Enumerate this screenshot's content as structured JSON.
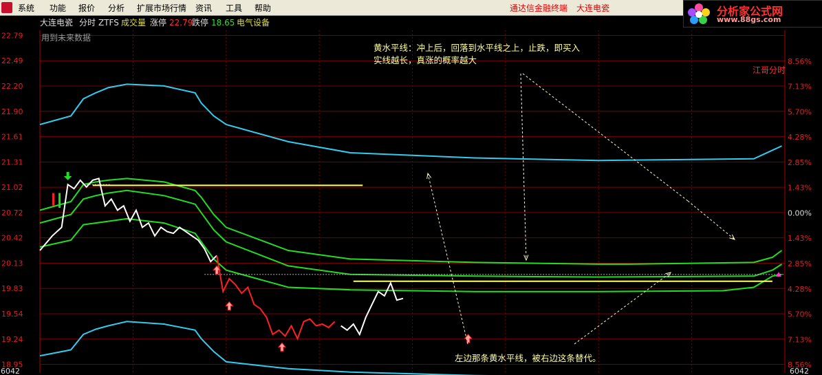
{
  "menubar": {
    "items": [
      "系统",
      "功能",
      "报价",
      "分析",
      "扩展市场行情",
      "资讯",
      "工具",
      "帮助"
    ],
    "app_title": "通达信金融终端",
    "stock_title": "大连电瓷"
  },
  "logo": {
    "line1": "分析家公式网",
    "line2": "www.88gs.com"
  },
  "header": {
    "stock": "大连电瓷",
    "view": "分时",
    "formula": "ZTFS",
    "volume_label": "成交量",
    "limit_up_label": "涨停",
    "limit_up": "22.79",
    "limit_down_label": "跌停",
    "limit_down": "18.65",
    "sector": "电气设备",
    "future_data": "用到未来数据",
    "indicator": "江哥分时"
  },
  "annotations": {
    "note1_line1": "黄水平线：冲上后，回落到水平线之上，止跌，即买入",
    "note1_line2": "实线越长，真涨的概率越大",
    "note2": "左边那条黄水平线，被右边这条替代。"
  },
  "colors": {
    "price_up": "#ffffff",
    "price_down": "#ff2020",
    "band_outer": "#33ccee",
    "band_inner": "#22dd22",
    "signal_line": "#ffff66",
    "grid": "#7a0000",
    "axis_text": "#e02020",
    "annotation": "#ffff99"
  },
  "chart_data": {
    "type": "line",
    "y_left_ticks": [
      "22.79",
      "22.49",
      "22.20",
      "21.90",
      "21.61",
      "21.31",
      "21.02",
      "20.72",
      "20.42",
      "20.13",
      "19.83",
      "19.54",
      "19.24",
      "18.95"
    ],
    "y_right_ticks": [
      "8.56%",
      "7.13%",
      "5.70%",
      "4.28%",
      "2.85%",
      "1.43%",
      "0.00%",
      "1.43%",
      "2.85%",
      "4.28%",
      "5.70%",
      "7.13%",
      "8.56%"
    ],
    "volume_left": "6042",
    "volume_right": "6042",
    "ylim": [
      18.85,
      22.85
    ],
    "prev_close": 20.72,
    "signal_levels": [
      {
        "y": 21.04,
        "x_start": 17,
        "x_end": 104
      },
      {
        "y": 19.92,
        "x_start": 101,
        "x_end": 236
      }
    ],
    "dotted_levels": [
      {
        "y": 20.0,
        "x_start": 53,
        "x_end": 240
      }
    ],
    "price": {
      "x": [
        0,
        4,
        7,
        9,
        11,
        13,
        15,
        17,
        19,
        21,
        23,
        25,
        27,
        29,
        31,
        33,
        35,
        37,
        39,
        41,
        43,
        45,
        47,
        49,
        51,
        53,
        55,
        57,
        59,
        61,
        63,
        65,
        67,
        69,
        71,
        73,
        75,
        77,
        79,
        81,
        83,
        85,
        87,
        89,
        91,
        93,
        95,
        97,
        99,
        101,
        103,
        105,
        107,
        109,
        111,
        113,
        115,
        117,
        119,
        121,
        123,
        125,
        127,
        129,
        131,
        133,
        135,
        137,
        139,
        141,
        143,
        145,
        147,
        149,
        151,
        153,
        155,
        157,
        159,
        161,
        163,
        165,
        167,
        169,
        171,
        173,
        175,
        177,
        179,
        181,
        183,
        185,
        187,
        189,
        191,
        193,
        195,
        197,
        199,
        201,
        203,
        205,
        207,
        209,
        211,
        213,
        215,
        217,
        219,
        221,
        223,
        225,
        227,
        229,
        231,
        233,
        235,
        237,
        239
      ],
      "y": [
        20.28,
        20.45,
        20.55,
        21.05,
        21.0,
        21.1,
        21.02,
        21.1,
        21.12,
        20.8,
        20.88,
        20.75,
        20.8,
        20.62,
        20.75,
        20.55,
        20.6,
        20.45,
        20.55,
        20.5,
        20.48,
        20.55,
        20.5,
        20.45,
        20.4,
        20.3,
        20.15,
        20.22,
        19.8,
        19.95,
        19.88,
        19.78,
        19.85,
        19.65,
        19.6,
        19.5,
        19.3,
        19.35,
        19.28,
        19.4,
        19.25,
        19.45,
        19.48,
        19.4,
        19.42,
        19.38,
        19.45,
        19.4,
        19.35,
        19.42,
        19.3,
        19.5,
        19.65,
        19.8,
        19.75,
        19.9,
        19.7,
        19.72,
        19.6,
        19.5,
        19.65,
        19.68,
        19.78,
        19.85,
        19.8,
        19.88,
        19.82,
        19.9,
        19.95,
        19.92,
        19.98,
        19.9,
        20.05,
        19.95,
        20.1,
        20.05,
        20.12,
        20.1,
        20.28,
        20.18,
        20.2,
        20.25,
        20.12,
        20.08,
        20.15,
        20.05,
        20.15,
        20.2,
        20.6,
        20.35,
        20.4,
        20.45,
        20.5,
        20.7,
        20.8,
        20.7,
        20.85,
        20.75,
        21.25,
        21.05,
        21.1,
        21.0,
        21.03,
        21.01,
        20.98,
        21.0,
        21.02,
        20.95,
        21.0,
        21.02,
        21.05,
        21.1,
        21.05,
        21.15,
        21.3,
        21.1,
        21.05,
        21.02,
        21.0
      ],
      "up_segments": [
        [
          0,
          57
        ],
        [
          96,
          118
        ]
      ],
      "down_segments": [
        [
          57,
          96
        ]
      ]
    },
    "band_outer_upper": {
      "x": [
        0,
        10,
        14,
        18,
        22,
        28,
        40,
        50,
        52,
        56,
        60,
        80,
        100,
        140,
        180,
        230,
        236,
        239
      ],
      "y": [
        21.75,
        21.85,
        22.05,
        22.12,
        22.18,
        22.22,
        22.2,
        22.12,
        22.0,
        21.85,
        21.75,
        21.55,
        21.42,
        21.36,
        21.33,
        21.35,
        21.45,
        21.5
      ]
    },
    "band_outer_lower": {
      "x": [
        0,
        10,
        14,
        18,
        22,
        28,
        40,
        50,
        52,
        56,
        60,
        80,
        100,
        140,
        180
      ],
      "y": [
        19.05,
        19.12,
        19.3,
        19.36,
        19.4,
        19.45,
        19.42,
        19.35,
        19.25,
        19.1,
        18.98,
        18.9,
        18.86,
        18.82,
        18.8
      ]
    },
    "band_inner_upper": {
      "x": [
        0,
        10,
        14,
        18,
        22,
        28,
        40,
        50,
        52,
        56,
        60,
        80,
        100,
        140,
        180,
        190,
        230,
        236,
        239
      ],
      "y": [
        20.75,
        20.85,
        21.05,
        21.08,
        21.1,
        21.12,
        21.08,
        20.98,
        20.9,
        20.7,
        20.55,
        20.28,
        20.18,
        20.14,
        20.12,
        20.12,
        20.14,
        20.2,
        20.28
      ]
    },
    "band_inner_mid": {
      "x": [
        0,
        10,
        14,
        18,
        22,
        28,
        40,
        50,
        52,
        56,
        60,
        80,
        100,
        140,
        180,
        230,
        236,
        239
      ],
      "y": [
        20.6,
        20.7,
        20.88,
        20.92,
        20.95,
        20.98,
        20.92,
        20.82,
        20.72,
        20.52,
        20.38,
        20.1,
        20.0,
        19.98,
        19.97,
        19.98,
        20.05,
        20.12
      ]
    },
    "band_inner_lower": {
      "x": [
        0,
        10,
        14,
        18,
        22,
        28,
        40,
        50,
        52,
        56,
        60,
        80,
        100,
        140,
        180,
        220,
        230,
        236,
        239
      ],
      "y": [
        20.32,
        20.4,
        20.58,
        20.6,
        20.62,
        20.65,
        20.6,
        20.48,
        20.38,
        20.18,
        20.05,
        19.85,
        19.82,
        19.8,
        19.8,
        19.81,
        19.85,
        19.98,
        20.0
      ]
    },
    "signals": {
      "up_arrows": [
        {
          "x": 57,
          "y": 20.1
        },
        {
          "x": 61,
          "y": 19.68
        },
        {
          "x": 78,
          "y": 19.2
        },
        {
          "x": 138,
          "y": 19.3
        }
      ],
      "green_arrow": {
        "x": 9,
        "y": 21.1
      },
      "magenta_triangle": {
        "x": 238,
        "y": 19.99
      }
    },
    "volume_bars": [
      {
        "x": 4,
        "color": "#ff2020",
        "h": 0.55
      },
      {
        "x": 6,
        "color": "#22dd22",
        "h": 0.65
      }
    ]
  }
}
